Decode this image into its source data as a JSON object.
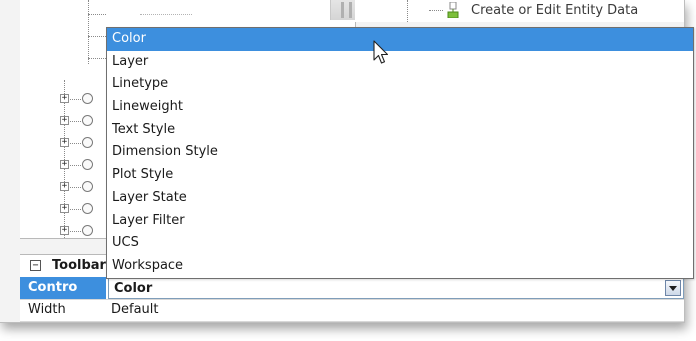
{
  "right_pane": {
    "entity_label": "Create or Edit Entity Data"
  },
  "tree": {
    "nodes": [
      {
        "expander": "+"
      },
      {
        "expander": "+"
      },
      {
        "expander": "+"
      },
      {
        "expander": "+"
      },
      {
        "expander": "+"
      },
      {
        "expander": "+"
      },
      {
        "expander": "+"
      }
    ]
  },
  "dropdown": {
    "items": [
      "Color",
      "Layer",
      "Linetype",
      "Lineweight",
      "Text Style",
      "Dimension Style",
      "Plot Style",
      "Layer State",
      "Layer Filter",
      "UCS",
      "Workspace"
    ],
    "highlighted_index": 0
  },
  "grid": {
    "category": {
      "collapse_glyph": "⊟",
      "title": "Toolbar"
    },
    "rows": [
      {
        "name": "Contro",
        "value": "Color"
      },
      {
        "name": "Width",
        "value": "Default"
      }
    ]
  },
  "colors": {
    "selection": "#3d8fde",
    "pane_bg": "#ffffff",
    "frame_bg": "#f3f3f3"
  }
}
